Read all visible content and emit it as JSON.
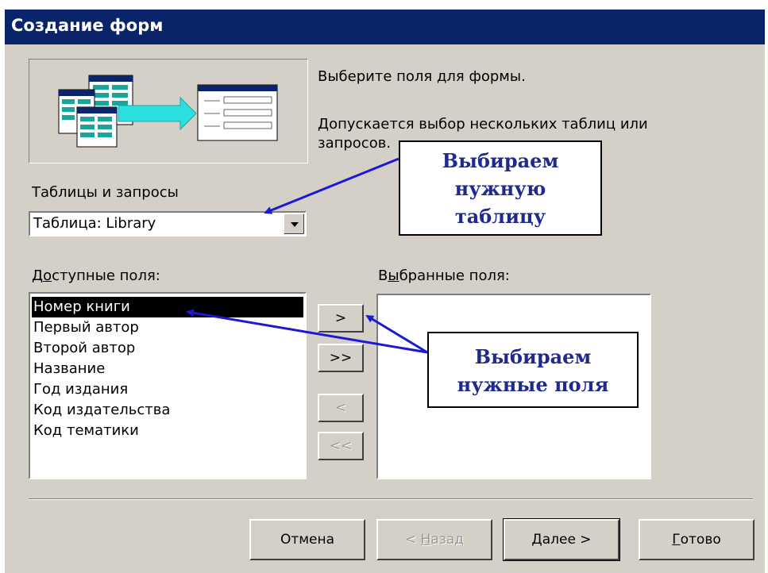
{
  "window": {
    "title": "Создание форм"
  },
  "instructions": {
    "line1": "Выберите поля для формы.",
    "line2": "Допускается выбор нескольких таблиц или",
    "line3": "запросов."
  },
  "tables": {
    "label": "Таблицы и запросы",
    "selected": "Таблица: Library"
  },
  "available": {
    "label_pre": "Д",
    "label_mn": "о",
    "label_post": "ступные поля:",
    "items": [
      "Номер книги",
      "Первый автор",
      "Второй автор",
      "Название",
      "Год издания",
      "Код издательства",
      "Код тематики"
    ]
  },
  "chosen": {
    "label_pre": "В",
    "label_mn": "ы",
    "label_post": "бранные поля:"
  },
  "move_buttons": {
    "add_one": ">",
    "add_all": ">>",
    "remove_one": "<",
    "remove_all": "<<"
  },
  "footer": {
    "cancel": "Отмена",
    "back_pre": "< ",
    "back_mn": "Н",
    "back_post": "азад",
    "next_mn": "Д",
    "next_post": "алее >",
    "finish_mn": "Г",
    "finish_post": "отово"
  },
  "annotations": {
    "table_callout": [
      "Выбираем",
      "нужную",
      "таблицу"
    ],
    "fields_callout": [
      "Выбираем",
      "нужные поля"
    ]
  },
  "colors": {
    "titlebar": "#0a246a",
    "dialog_face": "#d4d0c8",
    "annotation_text": "#1f2a8c",
    "arrow": "#1a1ad4"
  }
}
